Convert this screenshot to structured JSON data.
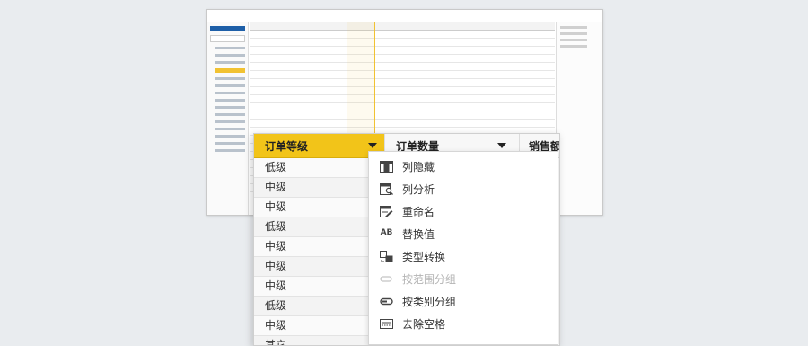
{
  "zoom": {
    "column1": {
      "header": "订单等级",
      "cells": [
        "低级",
        "中级",
        "中级",
        "低级",
        "中级",
        "中级",
        "中级",
        "低级",
        "中级",
        "其它"
      ]
    },
    "column2": {
      "header": "订单数量"
    },
    "column3": {
      "header": "销售额"
    }
  },
  "menu": {
    "items": [
      {
        "label": "列隐藏",
        "icon": "column-hide-icon",
        "enabled": true
      },
      {
        "label": "列分析",
        "icon": "column-analyze-icon",
        "enabled": true
      },
      {
        "label": "重命名",
        "icon": "rename-icon",
        "enabled": true
      },
      {
        "label": "替换值",
        "icon": "replace-value-icon",
        "icon_text": "AB",
        "enabled": true
      },
      {
        "label": "类型转换",
        "icon": "type-convert-icon",
        "enabled": true
      },
      {
        "label": "按范围分组",
        "icon": "group-by-range-icon",
        "enabled": false
      },
      {
        "label": "按类别分组",
        "icon": "group-by-category-icon",
        "enabled": true
      },
      {
        "label": "去除空格",
        "icon": "trim-spaces-icon",
        "enabled": true
      }
    ]
  },
  "colors": {
    "accent": "#f2c419",
    "disabled_text": "#b5b5b5"
  }
}
